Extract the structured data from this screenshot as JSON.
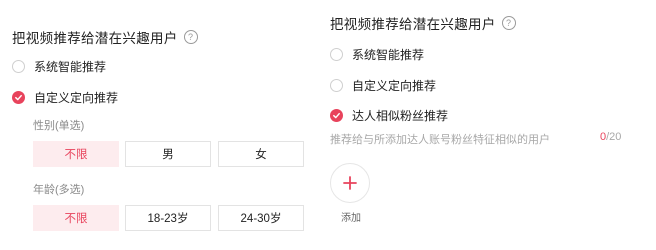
{
  "left": {
    "title": "把视频推荐给潜在兴趣用户",
    "help_icon": "question-circle-icon",
    "options": [
      {
        "label": "系统智能推荐",
        "checked": false
      },
      {
        "label": "自定义定向推荐",
        "checked": true
      }
    ],
    "gender": {
      "label": "性别(单选)",
      "choices": [
        {
          "label": "不限",
          "selected": true
        },
        {
          "label": "男",
          "selected": false
        },
        {
          "label": "女",
          "selected": false
        }
      ]
    },
    "age": {
      "label": "年龄(多选)",
      "choices": [
        {
          "label": "不限",
          "selected": true
        },
        {
          "label": "18-23岁",
          "selected": false
        },
        {
          "label": "24-30岁",
          "selected": false
        }
      ]
    }
  },
  "right": {
    "title": "把视频推荐给潜在兴趣用户",
    "help_icon": "question-circle-icon",
    "options": [
      {
        "label": "系统智能推荐",
        "checked": false
      },
      {
        "label": "自定义定向推荐",
        "checked": false
      },
      {
        "label": "达人相似粉丝推荐",
        "checked": true
      }
    ],
    "hint": "推荐给与所添加达人账号粉丝特征相似的用户",
    "counter": {
      "current": "0",
      "max": "/20"
    },
    "add_label": "添加"
  },
  "colors": {
    "accent": "#e8435c",
    "accent_bg": "#fdecee",
    "border": "#e3e3e3"
  }
}
